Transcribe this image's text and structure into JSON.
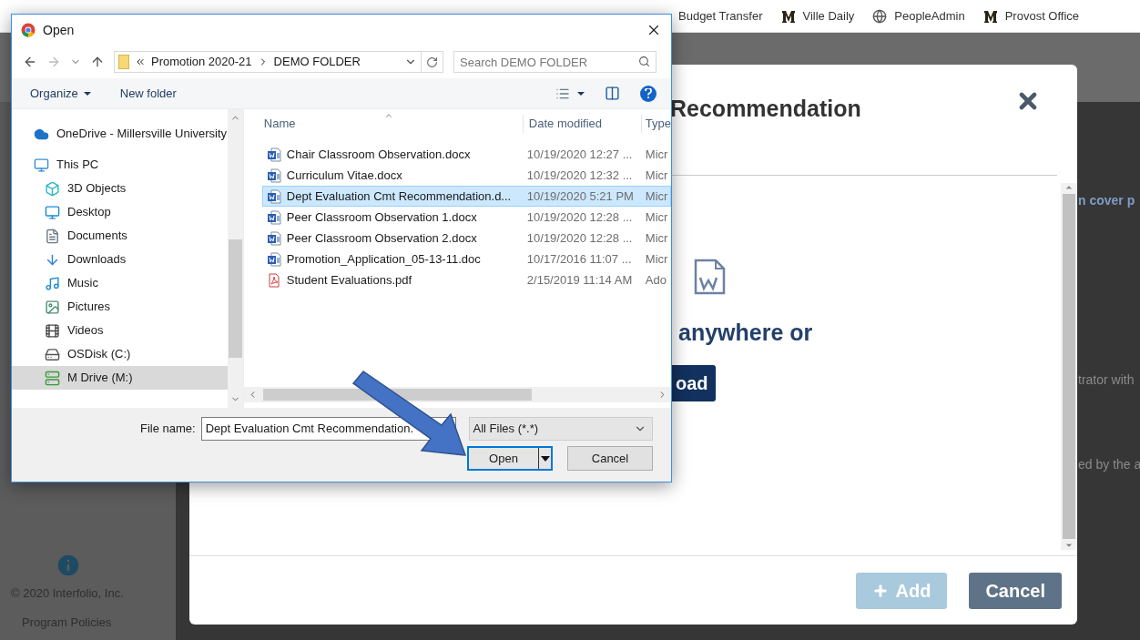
{
  "bookmarks": [
    {
      "label": "Budget Transfer",
      "kind": "none"
    },
    {
      "label": "Ville Daily",
      "kind": "mu"
    },
    {
      "label": "PeopleAdmin",
      "kind": "globe"
    },
    {
      "label": "Provost Office",
      "kind": "mu"
    }
  ],
  "page": {
    "copyright": "© 2020 Interfolio, Inc.",
    "policies_link": "Program Policies",
    "snippets": [
      "n cover p",
      "trator with",
      "ed by the a"
    ]
  },
  "modal": {
    "title": "Recommendation",
    "drop_text": "anywhere or",
    "upload_button": "oad",
    "buttons": [
      {
        "label": "Add",
        "kind": "add",
        "disabled": true
      },
      {
        "label": "Cancel",
        "kind": "cancel",
        "disabled": false
      }
    ]
  },
  "dialog": {
    "title": "Open",
    "path": [
      "Promotion 2020-21",
      "DEMO FOLDER"
    ],
    "search_placeholder": "Search DEMO FOLDER",
    "commands": [
      "Organize",
      "New folder"
    ],
    "nav": [
      {
        "label": "OneDrive - Millersville University",
        "kind": "cloud",
        "selected": false
      },
      {
        "label": "This PC",
        "kind": "pc",
        "selected": false,
        "children": [
          {
            "label": "3D Objects",
            "kind": "cube",
            "selected": false
          },
          {
            "label": "Desktop",
            "kind": "desktop",
            "selected": false
          },
          {
            "label": "Documents",
            "kind": "documents",
            "selected": false
          },
          {
            "label": "Downloads",
            "kind": "download",
            "selected": false
          },
          {
            "label": "Music",
            "kind": "music",
            "selected": false
          },
          {
            "label": "Pictures",
            "kind": "pictures",
            "selected": false
          },
          {
            "label": "Videos",
            "kind": "videos",
            "selected": false
          },
          {
            "label": "OSDisk (C:)",
            "kind": "disk",
            "selected": false
          },
          {
            "label": "M Drive (M:)",
            "kind": "netdrive",
            "selected": true
          }
        ]
      }
    ],
    "columns": [
      "Name",
      "Date modified",
      "Type"
    ],
    "files": [
      {
        "name": "Chair Classroom Observation.docx",
        "date": "10/19/2020 12:27 ...",
        "type": "Micr",
        "kind": "word",
        "selected": false
      },
      {
        "name": "Curriculum Vitae.docx",
        "date": "10/19/2020 12:32 ...",
        "type": "Micr",
        "kind": "word",
        "selected": false
      },
      {
        "name": "Dept Evaluation Cmt Recommendation.d...",
        "date": "10/19/2020 5:21 PM",
        "type": "Micr",
        "kind": "word",
        "selected": true
      },
      {
        "name": "Peer Classroom Observation 1.docx",
        "date": "10/19/2020 12:28 ...",
        "type": "Micr",
        "kind": "word",
        "selected": false
      },
      {
        "name": "Peer Classroom Observation 2.docx",
        "date": "10/19/2020 12:28 ...",
        "type": "Micr",
        "kind": "word",
        "selected": false
      },
      {
        "name": "Promotion_Application_05-13-11.doc",
        "date": "10/17/2016 11:07 ...",
        "type": "Micr",
        "kind": "word",
        "selected": false
      },
      {
        "name": "Student Evaluations.pdf",
        "date": "2/15/2019 11:14 AM",
        "type": "Ado",
        "kind": "pdf",
        "selected": false
      }
    ],
    "file_name_label": "File name:",
    "file_name": "Dept Evaluation Cmt Recommendation.",
    "filter": "All Files (*.*)",
    "open_button": "Open",
    "cancel_button": "Cancel"
  }
}
